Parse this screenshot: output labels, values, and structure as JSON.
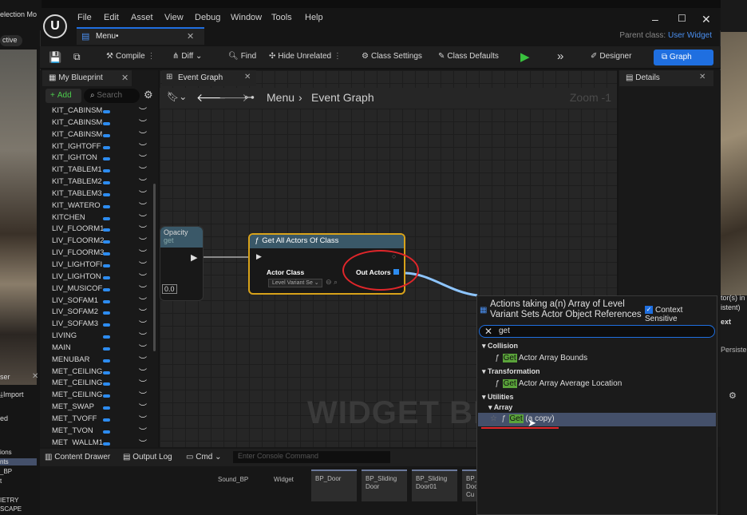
{
  "menu": {
    "items": [
      "File",
      "Edit",
      "Asset",
      "View",
      "Debug",
      "Window",
      "Tools",
      "Help"
    ]
  },
  "doc_tab": "Menu•",
  "parent_class_label": "Parent class:",
  "parent_class_value": "User Widget",
  "left_edge": {
    "top_label": "election Mo",
    "active_label": "ctive"
  },
  "toolbar": {
    "compile": "Compile",
    "diff": "Diff",
    "find": "Find",
    "hide_unrelated": "Hide Unrelated",
    "class_settings": "Class Settings",
    "class_defaults": "Class Defaults",
    "designer": "Designer",
    "graph": "Graph"
  },
  "my_blueprint": {
    "title": "My Blueprint",
    "add": "Add",
    "search_placeholder": "Search",
    "variables": [
      "KIT_CABINSM",
      "KIT_CABINSM",
      "KIT_CABINSM",
      "KIT_IGHTOFF",
      "KIT_IGHTON",
      "KIT_TABLEM1",
      "KIT_TABLEM2",
      "KIT_TABLEM3",
      "KIT_WATERO",
      "KITCHEN",
      "LIV_FLOORM1",
      "LIV_FLOORM2",
      "LIV_FLOORM3",
      "LIV_LIGHTOFI",
      "LIV_LIGHTON",
      "LIV_MUSICOF",
      "LIV_SOFAM1",
      "LIV_SOFAM2",
      "LIV_SOFAM3",
      "LIVING",
      "MAIN",
      "MENUBAR",
      "MET_CEILING",
      "MET_CEILING",
      "MET_CEILING",
      "MET_SWAP",
      "MET_TVOFF",
      "MET_TVON",
      "MET_WALLM1"
    ]
  },
  "event_graph": {
    "tab": "Event Graph",
    "crumb1": "Menu",
    "crumb2": "Event Graph",
    "zoom": "Zoom -1",
    "watermark": "WIDGET BL"
  },
  "nodes": {
    "opacity": {
      "title": "Opacity",
      "sub": "get",
      "value": "0.0"
    },
    "get_all_actors": {
      "title": "Get All Actors Of Class",
      "actor_class_label": "Actor Class",
      "actor_class_value": "Level Variant Se",
      "out_actors": "Out Actors"
    }
  },
  "details": {
    "title": "Details"
  },
  "right_edge": {
    "line1": "tor(s) in",
    "line2": "istent)",
    "line3": "ext",
    "line4": "Persiste"
  },
  "bottom": {
    "content_drawer": "Content Drawer",
    "output_log": "Output Log",
    "cmd": "Cmd",
    "console_placeholder": "Enter Console Command",
    "assets": [
      "Sound_BP",
      "Widget",
      "BP_Door",
      "BP_Sliding Door",
      "BP_Sliding Door01",
      "BP_ Doo Cu"
    ]
  },
  "left_bottom": {
    "ser": "ser",
    "import": "Import",
    "ed": "ed",
    "list": [
      "ions",
      "nts",
      "_BP",
      "t",
      "",
      "IETRY",
      "SCAPE"
    ]
  },
  "popup": {
    "title": "Actions taking a(n) Array of Level Variant Sets Actor Object References",
    "context_sensitive": "Context Sensitive",
    "search_value": "get",
    "categories": [
      {
        "name": "Collision",
        "action_hl": "Get",
        "action_rest": " Actor Array Bounds"
      },
      {
        "name": "Transformation",
        "action_hl": "Get",
        "action_rest": " Actor Array Average Location"
      }
    ],
    "utilities": "Utilities",
    "array": "Array",
    "selected_hl": "Get",
    "selected_rest": " (a copy)"
  },
  "colors": {
    "accent": "#1f6fe0",
    "annotation_red": "#e0262a",
    "node_border": "#d8a21a",
    "match_green": "#5aa33a"
  }
}
